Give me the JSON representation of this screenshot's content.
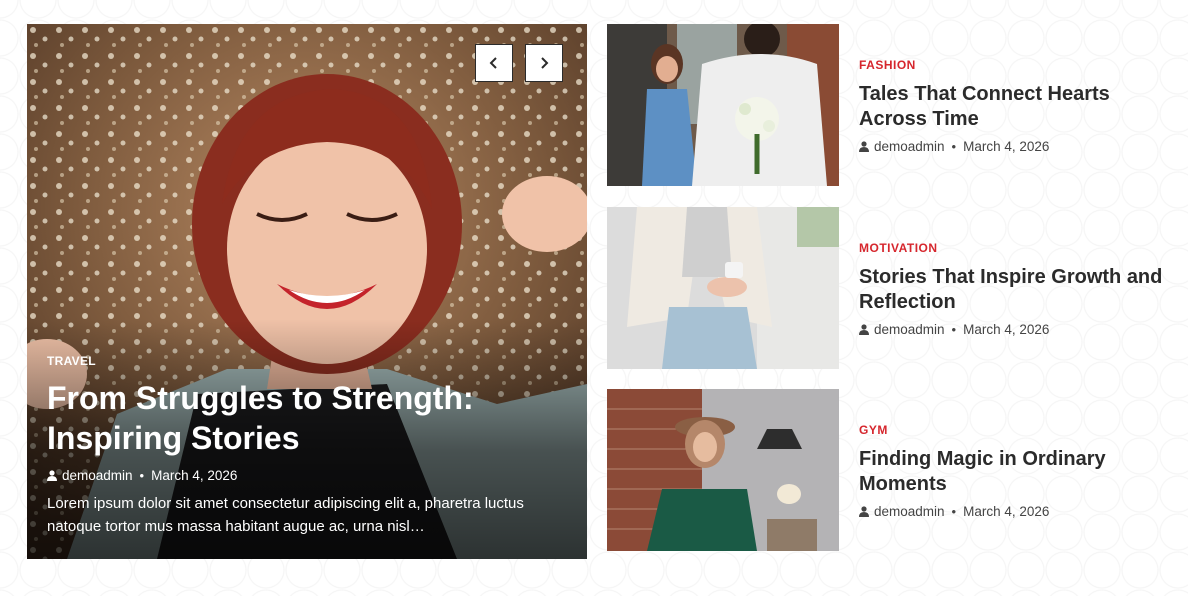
{
  "slider": {
    "prev_icon": "chevron-left-icon",
    "next_icon": "chevron-right-icon"
  },
  "hero": {
    "category": "TRAVEL",
    "title": "From Struggles to Strength: Inspiring Stories",
    "author": "demoadmin",
    "date": "March 4, 2026",
    "excerpt": "Lorem ipsum dolor sit amet consectetur adipiscing elit a, pharetra luctus natoque tortor mus massa habitant augue ac, urna nisl…"
  },
  "posts": [
    {
      "category": "FASHION",
      "title": "Tales That Connect Hearts Across Time",
      "author": "demoadmin",
      "date": "March 4, 2026"
    },
    {
      "category": "MOTIVATION",
      "title": "Stories That Inspire Growth and Reflection",
      "author": "demoadmin",
      "date": "March 4, 2026"
    },
    {
      "category": "GYM",
      "title": "Finding Magic in Ordinary Moments",
      "author": "demoadmin",
      "date": "March 4, 2026"
    }
  ],
  "colors": {
    "category_accent": "#d6262d",
    "title_text": "#2b2b2b",
    "meta_text": "#444444"
  },
  "icons": {
    "author": "user-icon",
    "separator": "•"
  }
}
